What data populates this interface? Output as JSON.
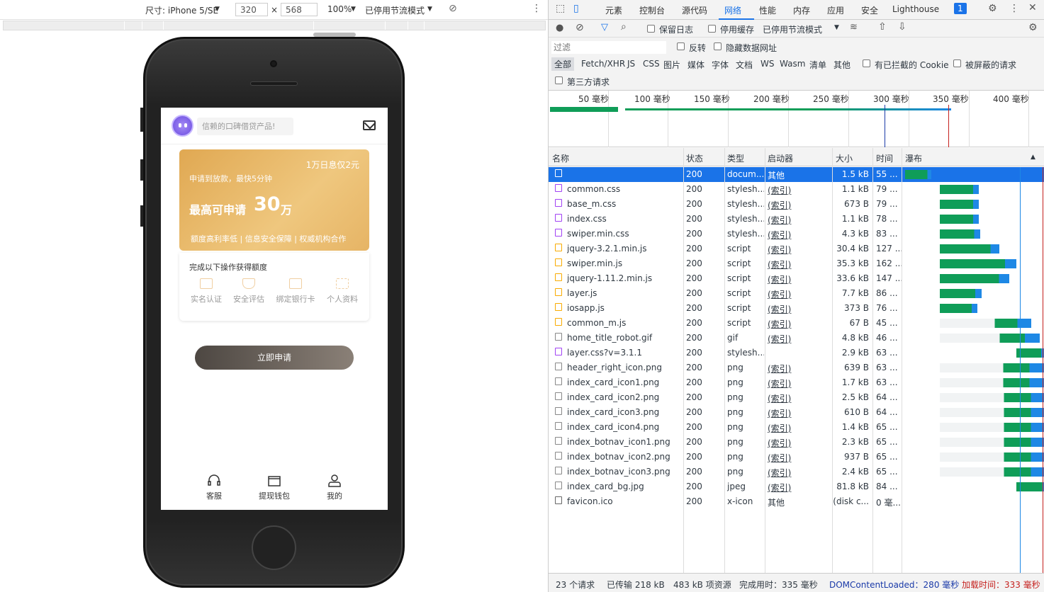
{
  "device_toolbar": {
    "dimensions_label": "尺寸: iPhone 5/SE",
    "width_value": "320",
    "times": "×",
    "height_value": "568",
    "zoom": "100%",
    "throttle": "已停用节流模式"
  },
  "app": {
    "search_placeholder": "信赖的口碑借贷产品!",
    "card": {
      "rate": "1万日息仅2元",
      "subtitle": "申请到放款，最快5分钟",
      "max_label": "最高可申请",
      "amount": "30",
      "unit": "万",
      "features": "额度高利率低 | 信息安全保障 | 权威机构合作"
    },
    "tasks_title": "完成以下操作获得额度",
    "tasks": [
      {
        "label": "实名认证",
        "icon": "id-card-icon"
      },
      {
        "label": "安全评估",
        "icon": "shield-icon"
      },
      {
        "label": "绑定银行卡",
        "icon": "bank-card-icon"
      },
      {
        "label": "个人资料",
        "icon": "scan-icon"
      }
    ],
    "apply_button": "立即申请",
    "bottom_nav": [
      {
        "label": "客服",
        "icon": "headset-icon"
      },
      {
        "label": "提现钱包",
        "icon": "wallet-icon"
      },
      {
        "label": "我的",
        "icon": "user-icon"
      }
    ]
  },
  "devtools": {
    "tabs": [
      "元素",
      "控制台",
      "源代码",
      "网络",
      "性能",
      "内存",
      "应用",
      "安全",
      "Lighthouse"
    ],
    "active_tab": "网络",
    "issues_badge": "1",
    "toolbar": {
      "preserve_log": "保留日志",
      "disable_cache": "停用缓存",
      "throttle": "已停用节流模式"
    },
    "filter": {
      "placeholder": "过滤",
      "invert": "反转",
      "hide_data_urls": "隐藏数据网址",
      "types": [
        "全部",
        "Fetch/XHR",
        "JS",
        "CSS",
        "图片",
        "媒体",
        "字体",
        "文档",
        "WS",
        "Wasm",
        "清单",
        "其他"
      ],
      "blocked_cookies": "有已拦截的 Cookie",
      "blocked_requests": "被屏蔽的请求",
      "third_party": "第三方请求"
    },
    "timeline_ticks": [
      "50 毫秒",
      "100 毫秒",
      "150 毫秒",
      "200 毫秒",
      "250 毫秒",
      "300 毫秒",
      "350 毫秒",
      "400 毫秒"
    ],
    "columns": [
      "名称",
      "状态",
      "类型",
      "启动器",
      "大小",
      "时间",
      "瀑布"
    ],
    "rows": [
      {
        "name": "",
        "status": "200",
        "type": "docum...",
        "initiator": "其他",
        "size": "1.5 kB",
        "time": "55 ...",
        "icon": "doc",
        "wf_start": 0.0,
        "wf_len": 0.19
      },
      {
        "name": "common.css",
        "status": "200",
        "type": "stylesh...",
        "initiator": "(索引)",
        "size": "1.1 kB",
        "time": "79 ...",
        "icon": "css",
        "wf_start": 0.25,
        "wf_len": 0.28
      },
      {
        "name": "base_m.css",
        "status": "200",
        "type": "stylesh...",
        "initiator": "(索引)",
        "size": "673 B",
        "time": "79 ...",
        "icon": "css",
        "wf_start": 0.25,
        "wf_len": 0.28
      },
      {
        "name": "index.css",
        "status": "200",
        "type": "stylesh...",
        "initiator": "(索引)",
        "size": "1.1 kB",
        "time": "78 ...",
        "icon": "css",
        "wf_start": 0.25,
        "wf_len": 0.28
      },
      {
        "name": "swiper.min.css",
        "status": "200",
        "type": "stylesh...",
        "initiator": "(索引)",
        "size": "4.3 kB",
        "time": "83 ...",
        "icon": "css",
        "wf_start": 0.25,
        "wf_len": 0.29
      },
      {
        "name": "jquery-3.2.1.min.js",
        "status": "200",
        "type": "script",
        "initiator": "(索引)",
        "size": "30.4 kB",
        "time": "127 ...",
        "icon": "js",
        "wf_start": 0.25,
        "wf_len": 0.43
      },
      {
        "name": "swiper.min.js",
        "status": "200",
        "type": "script",
        "initiator": "(索引)",
        "size": "35.3 kB",
        "time": "162 ...",
        "icon": "js",
        "wf_start": 0.25,
        "wf_len": 0.55
      },
      {
        "name": "jquery-1.11.2.min.js",
        "status": "200",
        "type": "script",
        "initiator": "(索引)",
        "size": "33.6 kB",
        "time": "147 ...",
        "icon": "js",
        "wf_start": 0.25,
        "wf_len": 0.5
      },
      {
        "name": "layer.js",
        "status": "200",
        "type": "script",
        "initiator": "(索引)",
        "size": "7.7 kB",
        "time": "86 ...",
        "icon": "js",
        "wf_start": 0.25,
        "wf_len": 0.3
      },
      {
        "name": "iosapp.js",
        "status": "200",
        "type": "script",
        "initiator": "(索引)",
        "size": "373 B",
        "time": "76 ...",
        "icon": "js",
        "wf_start": 0.25,
        "wf_len": 0.27
      },
      {
        "name": "common_m.js",
        "status": "200",
        "type": "script",
        "initiator": "(索引)",
        "size": "67 B",
        "time": "45 ...",
        "icon": "js",
        "wf_start": 0.25,
        "wf_len": 0.66
      },
      {
        "name": "home_title_robot.gif",
        "status": "200",
        "type": "gif",
        "initiator": "(索引)",
        "size": "4.8 kB",
        "time": "46 ...",
        "icon": "img",
        "wf_start": 0.25,
        "wf_len": 0.72
      },
      {
        "name": "layer.css?v=3.1.1",
        "status": "200",
        "type": "stylesh...",
        "initiator": "",
        "size": "2.9 kB",
        "time": "63 ...",
        "icon": "css",
        "wf_start": 0.8,
        "wf_len": 0.21
      },
      {
        "name": "header_right_icon.png",
        "status": "200",
        "type": "png",
        "initiator": "(索引)",
        "size": "639 B",
        "time": "63 ...",
        "icon": "img",
        "wf_start": 0.25,
        "wf_len": 0.76
      },
      {
        "name": "index_card_icon1.png",
        "status": "200",
        "type": "png",
        "initiator": "(索引)",
        "size": "1.7 kB",
        "time": "63 ...",
        "icon": "img",
        "wf_start": 0.25,
        "wf_len": 0.76
      },
      {
        "name": "index_card_icon2.png",
        "status": "200",
        "type": "png",
        "initiator": "(索引)",
        "size": "2.5 kB",
        "time": "64 ...",
        "icon": "img",
        "wf_start": 0.25,
        "wf_len": 0.77
      },
      {
        "name": "index_card_icon3.png",
        "status": "200",
        "type": "png",
        "initiator": "(索引)",
        "size": "610 B",
        "time": "64 ...",
        "icon": "img",
        "wf_start": 0.25,
        "wf_len": 0.77
      },
      {
        "name": "index_card_icon4.png",
        "status": "200",
        "type": "png",
        "initiator": "(索引)",
        "size": "1.4 kB",
        "time": "65 ...",
        "icon": "img",
        "wf_start": 0.25,
        "wf_len": 0.77
      },
      {
        "name": "index_botnav_icon1.png",
        "status": "200",
        "type": "png",
        "initiator": "(索引)",
        "size": "2.3 kB",
        "time": "65 ...",
        "icon": "img",
        "wf_start": 0.25,
        "wf_len": 0.77
      },
      {
        "name": "index_botnav_icon2.png",
        "status": "200",
        "type": "png",
        "initiator": "(索引)",
        "size": "937 B",
        "time": "65 ...",
        "icon": "img",
        "wf_start": 0.25,
        "wf_len": 0.77
      },
      {
        "name": "index_botnav_icon3.png",
        "status": "200",
        "type": "png",
        "initiator": "(索引)",
        "size": "2.4 kB",
        "time": "65 ...",
        "icon": "img",
        "wf_start": 0.25,
        "wf_len": 0.77
      },
      {
        "name": "index_card_bg.jpg",
        "status": "200",
        "type": "jpeg",
        "initiator": "(索引)",
        "size": "81.8 kB",
        "time": "84 ...",
        "icon": "img",
        "wf_start": 0.8,
        "wf_len": 0.22
      },
      {
        "name": "favicon.ico",
        "status": "200",
        "type": "x-icon",
        "initiator": "其他",
        "size": "(disk c...",
        "time": "0 毫...",
        "icon": "other",
        "wf_start": 0,
        "wf_len": 0
      }
    ],
    "status_bar": {
      "requests": "23 个请求",
      "transferred": "已传输 218 kB",
      "resources": "483 kB 项资源",
      "finish": "完成用时：335 毫秒",
      "dcl": "DOMContentLoaded：280 毫秒",
      "load": "加载时间：333 毫秒"
    },
    "colors": {
      "accent": "#1a73e8",
      "wf_green": "#0f9d58",
      "wf_blue": "#1e88e5",
      "load_red": "#c5221f"
    }
  }
}
